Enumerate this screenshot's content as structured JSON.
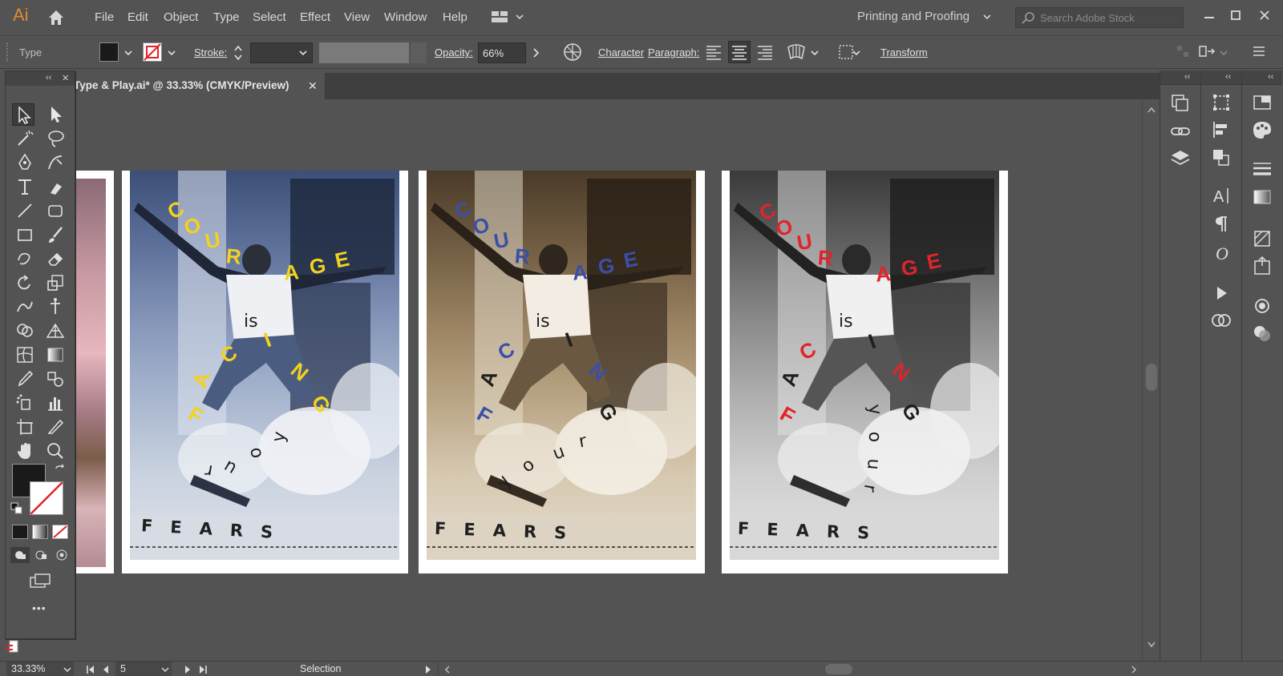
{
  "app": {
    "logo": "Ai"
  },
  "menu": [
    "File",
    "Edit",
    "Object",
    "Type",
    "Select",
    "Effect",
    "View",
    "Window",
    "Help"
  ],
  "workspace": "Printing and Proofing",
  "search": {
    "placeholder": "Search Adobe Stock"
  },
  "control_bar": {
    "selection_type": "Type",
    "stroke_label": "Stroke:",
    "opacity_label": "Opacity:",
    "opacity_value": "66%",
    "character_label": "Character",
    "paragraph_label": "Paragraph:",
    "transform_label": "Transform"
  },
  "document": {
    "tab_title": "Type & Play.ai* @ 33.33% (CMYK/Preview)",
    "close": "✕"
  },
  "tools_panel": {
    "more": "•••",
    "collapse": "‹‹",
    "close": "✕"
  },
  "posters": [
    {
      "tint": "blue",
      "accent": "#f2d21f",
      "word_courage": [
        "C",
        "O",
        "U",
        "R",
        "A",
        "G",
        "E"
      ],
      "word_is": "is",
      "word_facing": [
        "F",
        "A",
        "C",
        "I",
        "N",
        "G"
      ],
      "word_your": [
        "y",
        "o",
        "u",
        "r"
      ],
      "word_fears": "FEARS"
    },
    {
      "tint": "sepia",
      "accent": "#3a4fa8",
      "word_courage": [
        "C",
        "O",
        "U",
        "R",
        "A",
        "G",
        "E"
      ],
      "word_is": "is",
      "word_facing": [
        "F",
        "A",
        "C",
        "I",
        "N",
        "G"
      ],
      "word_your": [
        "y",
        "o",
        "u",
        "r"
      ],
      "word_fears": "FEARS"
    },
    {
      "tint": "gray",
      "accent": "#e2232a",
      "word_courage": [
        "C",
        "O",
        "U",
        "R",
        "A",
        "G",
        "E"
      ],
      "word_is": "is",
      "word_facing": [
        "F",
        "A",
        "C",
        "I",
        "N",
        "G"
      ],
      "word_your": [
        "y",
        "o",
        "u",
        "r"
      ],
      "word_fears": "FEARS"
    }
  ],
  "status_bar": {
    "zoom": "33.33%",
    "artboard": "5",
    "tool": "Selection"
  },
  "right_panels": {
    "collapse": "‹‹"
  }
}
